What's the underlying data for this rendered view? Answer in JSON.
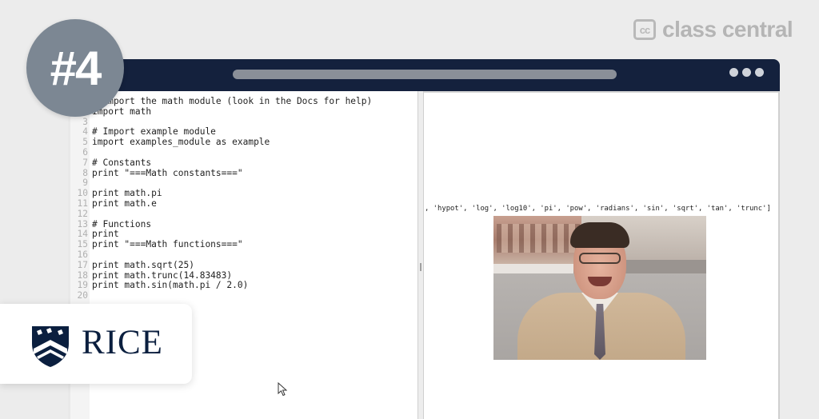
{
  "brand": {
    "classcentral_icon_text": "cc",
    "classcentral_text": "class central",
    "episode_badge": "#4",
    "university_name": "RICE"
  },
  "window": {
    "controls": [
      "dot",
      "dot",
      "dot"
    ]
  },
  "editor": {
    "lines": [
      {
        "num": "1",
        "text": "# Import the math module (look in the Docs for help)"
      },
      {
        "num": "2",
        "text": "import math"
      },
      {
        "num": "3",
        "text": ""
      },
      {
        "num": "4",
        "text": "# Import example module"
      },
      {
        "num": "5",
        "text": "import examples_module as example"
      },
      {
        "num": "6",
        "text": ""
      },
      {
        "num": "7",
        "text": "# Constants"
      },
      {
        "num": "8",
        "text": "print \"===Math constants===\""
      },
      {
        "num": "9",
        "text": ""
      },
      {
        "num": "10",
        "text": "print math.pi"
      },
      {
        "num": "11",
        "text": "print math.e"
      },
      {
        "num": "12",
        "text": ""
      },
      {
        "num": "13",
        "text": "# Functions"
      },
      {
        "num": "14",
        "text": "print"
      },
      {
        "num": "15",
        "text": "print \"===Math functions===\""
      },
      {
        "num": "16",
        "text": ""
      },
      {
        "num": "17",
        "text": "print math.sqrt(25)"
      },
      {
        "num": "18",
        "text": "print math.trunc(14.83483)"
      },
      {
        "num": "19",
        "text": "print math.sin(math.pi / 2.0)"
      },
      {
        "num": "20",
        "text": ""
      }
    ]
  },
  "output": {
    "line": ", 'hypot', 'log', 'log10', 'pi', 'pow', 'radians', 'sin', 'sqrt', 'tan', 'trunc']"
  },
  "colors": {
    "titlebar": "#14213d",
    "badge": "#7c8793",
    "rice_navy": "#0b1f3f"
  }
}
